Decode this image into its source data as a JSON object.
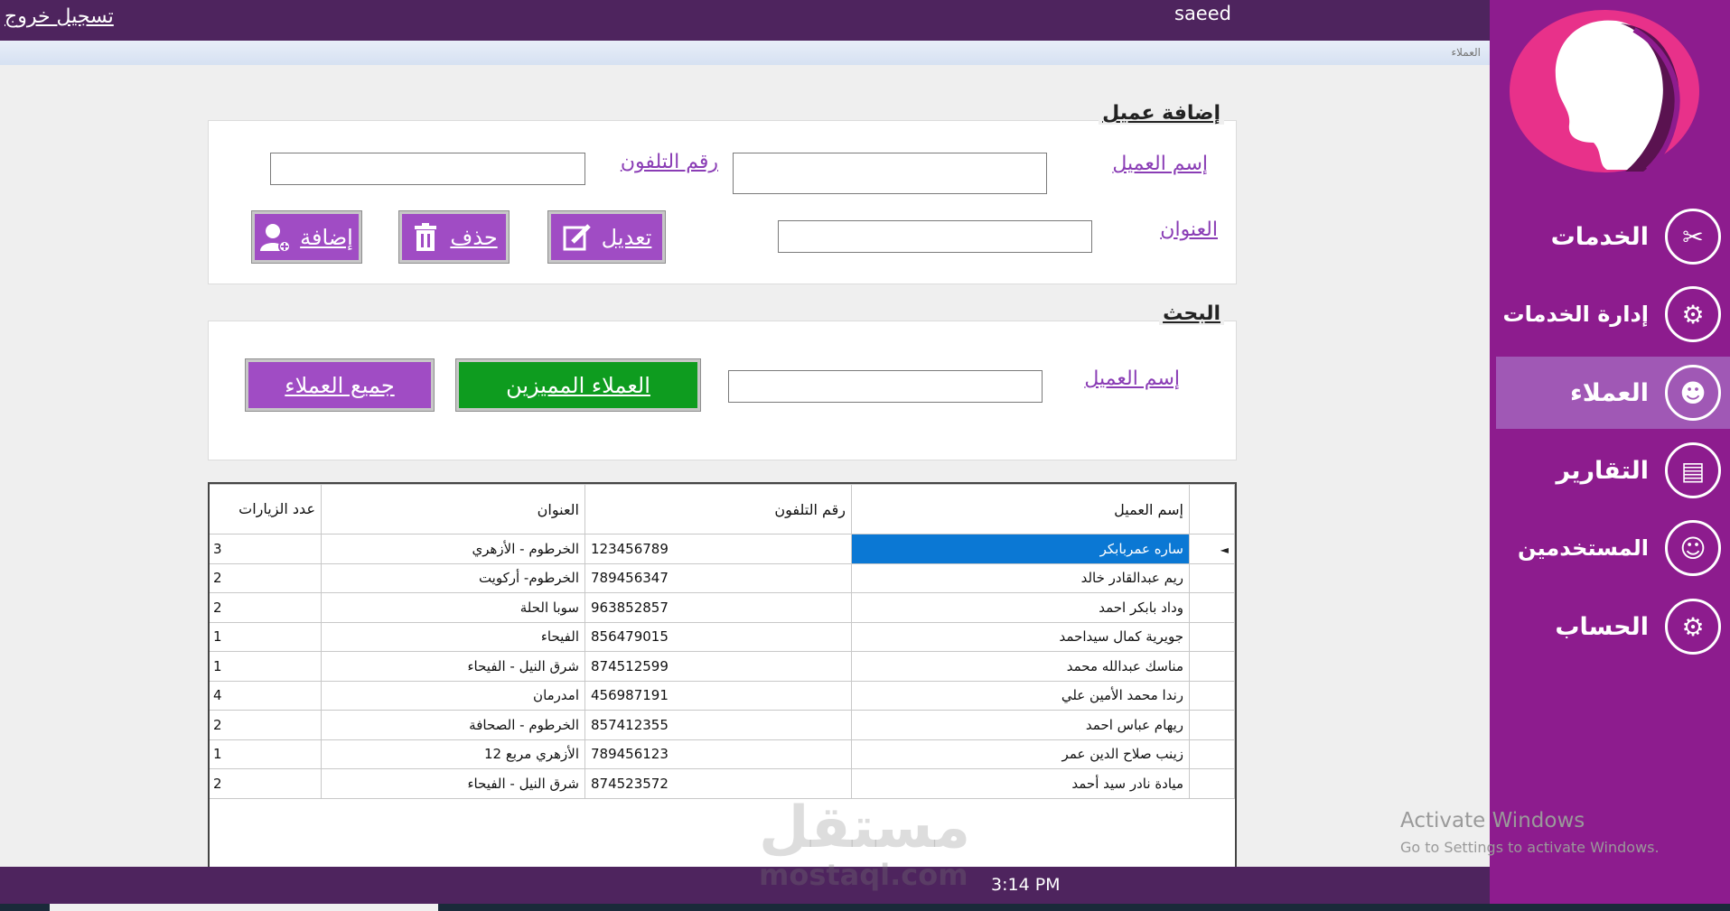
{
  "header": {
    "logout": "تسجيل خروج",
    "username": "saeed",
    "breadcrumb": "العملاء"
  },
  "sidebar": {
    "items": [
      {
        "label": "الخدمات",
        "icon": "salon-tools-icon"
      },
      {
        "label": "إدارة الخدمات",
        "icon": "settings-gear-icon"
      },
      {
        "label": "العملاء",
        "icon": "customers-group-icon",
        "active": true
      },
      {
        "label": "التقارير",
        "icon": "report-document-icon"
      },
      {
        "label": "المستخدمين",
        "icon": "users-icon"
      },
      {
        "label": "الحساب",
        "icon": "account-gear-icon"
      }
    ]
  },
  "add_panel": {
    "title": "إضافة عميل",
    "name_label": "إسم العميل",
    "phone_label": "رقم التلفون",
    "address_label": "العنوان",
    "name_value": "",
    "phone_value": "",
    "address_value": "",
    "edit_button": "تعديل",
    "delete_button": "حذف",
    "add_button": "إضافة"
  },
  "search_panel": {
    "title": "البحث",
    "name_label": "إسم العميل",
    "name_value": "",
    "featured_button": "العملاء المميزين",
    "all_button": "جميع العملاء"
  },
  "table": {
    "columns": [
      "إسم العميل",
      "رقم التلفون",
      "العنوان",
      "عدد الزيارات"
    ],
    "rows": [
      [
        "ساره عمربابكر",
        "123456789",
        "الخرطوم - الأزهري",
        "3"
      ],
      [
        "ريم عبدالقادر خالد",
        "789456347",
        "الخرطوم- أركويت",
        "2"
      ],
      [
        "وداد بابكر احمد",
        "963852857",
        "سوبا الحلة",
        "2"
      ],
      [
        "جويرية كمال سيداحمد",
        "856479015",
        "الفيحاء",
        "1"
      ],
      [
        "مناسك عبدالله محمد",
        "874512599",
        "شرق النيل - الفيحاء",
        "1"
      ],
      [
        "رندا محمد الأمين علي",
        "456987191",
        "امدرمان",
        "4"
      ],
      [
        "ريهام عباس احمد",
        "857412355",
        "الخرطوم - الصحافة",
        "2"
      ],
      [
        "زينب صلاح الدين عمر",
        "789456123",
        "الأزهري مربع 12",
        "1"
      ],
      [
        "ميادة نادر سيد أحمد",
        "874523572",
        "شرق النيل - الفيحاء",
        "2"
      ]
    ],
    "selected_row": 0
  },
  "footer": {
    "time": "3:14 PM"
  },
  "overlay": {
    "watermark": "مستقل",
    "watermark_url": "mostaql.com",
    "activate_title": "Activate Windows",
    "activate_sub": "Go to Settings to activate Windows."
  },
  "colors": {
    "top_bar": "#4e245e",
    "sidebar": "#8d1c8e",
    "active_nav": "#a058b5",
    "button_purple": "#a04cc4",
    "button_green": "#0e9c1f",
    "selection": "#0b78d4"
  }
}
